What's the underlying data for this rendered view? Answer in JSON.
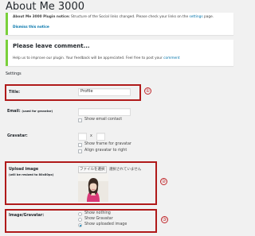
{
  "page": {
    "title": "About Me 3000"
  },
  "notice_structure": {
    "strong": "About Me 3000 Plugin notice:",
    "text_before_link": " Structure of the Social links changed. Please check your links on the ",
    "link_text": "settings",
    "text_after_link": " page.",
    "dismiss": "Dismiss this notice"
  },
  "notice_comment": {
    "heading": "Please leave comment...",
    "text_before_link": "Help us to improve our plugin. Your feedback will be appreciated. Feel free to post your ",
    "link_text": "comment"
  },
  "section_title": "Settings",
  "title_field": {
    "label": "Title:",
    "value": "Profile"
  },
  "email_field": {
    "label": "Email:",
    "note": "(used for gravatar)",
    "value": "",
    "show_email_label": "Show email contact",
    "show_email_checked": false
  },
  "gravatar_field": {
    "label": "Gravatar:",
    "separator": "x",
    "width_value": "",
    "height_value": "",
    "show_frame_label": "Show frame for gravatar",
    "show_frame_checked": false,
    "align_right_label": "Align gravatar to right",
    "align_right_checked": false
  },
  "upload_field": {
    "label": "Upload image",
    "note": "(will be resized to 80x80px)",
    "file_button": "ファイルを選択",
    "file_status": "選択されていません",
    "image_icon": "profile-photo"
  },
  "image_gravatar_field": {
    "label": "Image/Gravatar:",
    "options": [
      "Show nothing",
      "Show Gravatar",
      "Show uploaded image"
    ],
    "selected": "Show uploaded image"
  },
  "callouts": [
    "①",
    "②",
    "③"
  ],
  "colors": {
    "accent": "#0073aa",
    "highlight": "#b01a1a",
    "notice_border": "#7ad03a"
  }
}
